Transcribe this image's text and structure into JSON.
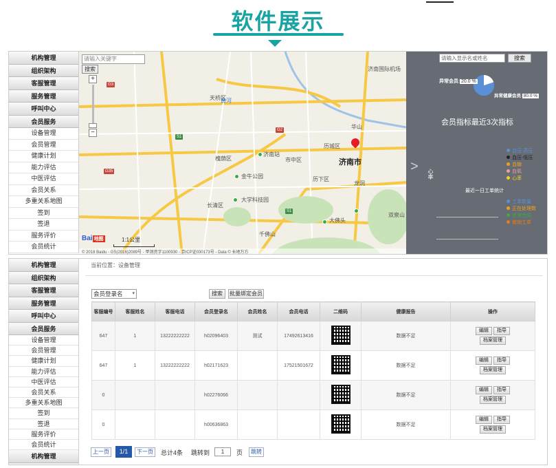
{
  "banner": {
    "title": "软件展示"
  },
  "sidebar_top": {
    "groups": [
      "机构管理",
      "组织架构",
      "客服管理",
      "服务管理",
      "呼叫中心",
      "会员服务"
    ],
    "items": [
      "设备管理",
      "会员管理",
      "健康计划",
      "能力评估",
      "中医评估",
      "会员关系",
      "多重关系地图",
      "签到",
      "签退",
      "服务评价",
      "会员统计"
    ]
  },
  "map": {
    "search_placeholder": "请输入关键字",
    "search_button": "搜索",
    "zoom_in": "+",
    "zoom_out": "−",
    "scale": "1:1公里",
    "logo": "Bai",
    "logo_box": "地图",
    "copyright": "© 2018 Baidu - GS(2016)2089号 - 甲测资字1100930 - 京ICP证030173号 - Data © 长地万方",
    "city": "济南市",
    "labels": [
      "天桥区",
      "历城区",
      "历下区",
      "市中区",
      "槐荫区",
      "长清区",
      "济南站",
      "龙洞",
      "华山",
      "金牛公园",
      "济南国际机场",
      "黄河",
      "大学科技园",
      "千佛山",
      "大佛头",
      "双泉山"
    ]
  },
  "dashboard": {
    "search_placeholder": "请输入显示名或姓名",
    "search_button": "搜索",
    "pct_a_label": "异常会员",
    "pct_a_value": "20.0 %",
    "pct_b_label": "异常健康会员",
    "pct_b_value": "80.0 %",
    "pie": {
      "slices": [
        {
          "value": 20.0,
          "color": "#ffffff"
        },
        {
          "value": 80.0,
          "color": "#5b8fd6"
        }
      ]
    },
    "heading": "会员指标最近3次指标",
    "arrow": ">",
    "vertical_label": "心率",
    "legend1": [
      {
        "label": "血压-高压",
        "color": "#5b8fd6"
      },
      {
        "label": "血压-低压",
        "color": "#222222"
      },
      {
        "label": "血糖",
        "color": "#f0a020"
      },
      {
        "label": "血氧",
        "color": "#e8a0a0"
      },
      {
        "label": "心率",
        "color": "#f0d020"
      }
    ],
    "sub_heading": "最近一日工单统计",
    "legend2": [
      {
        "label": "工单数量",
        "color": "#5b8fd6"
      },
      {
        "label": "正在处理数",
        "color": "#f0a020"
      },
      {
        "label": "处理完成",
        "color": "#3aaa4a"
      },
      {
        "label": "撤销工单",
        "color": "#e87a20"
      }
    ]
  },
  "sidebar_bottom": {
    "groups": [
      "机构管理",
      "组织架构",
      "客服管理",
      "服务管理",
      "呼叫中心",
      "会员服务"
    ],
    "items": [
      "设备管理",
      "会员管理",
      "健康计划",
      "能力评估",
      "中医评估",
      "会员关系",
      "多重关系地图",
      "签到",
      "签退",
      "服务评价",
      "会员统计"
    ],
    "tail": "机构管理"
  },
  "content": {
    "breadcrumb": "当前位置：设备管理",
    "filter_select": "会员登录名",
    "search_button": "搜索",
    "bind_button": "批量绑定会员",
    "columns": [
      "客服编号",
      "客服姓名",
      "客服电话",
      "会员登录名",
      "会员姓名",
      "会员电话",
      "二维码",
      "健康报告",
      "操作"
    ],
    "rows": [
      {
        "id": "647",
        "cs_name": "1",
        "cs_phone": "13222222222",
        "login": "h02096403",
        "name": "测试",
        "phone": "17492613416",
        "report": "数据不足"
      },
      {
        "id": "647",
        "cs_name": "1",
        "cs_phone": "13222222222",
        "login": "h02171623",
        "name": "",
        "phone": "17521501672",
        "report": "数据不足"
      },
      {
        "id": "0",
        "cs_name": "",
        "cs_phone": "",
        "login": "h02276066",
        "name": "",
        "phone": "",
        "report": "数据不足"
      },
      {
        "id": "0",
        "cs_name": "",
        "cs_phone": "",
        "login": "h00636863",
        "name": "",
        "phone": "",
        "report": "数据不足"
      }
    ],
    "op_edit": "编辑",
    "op_guide": "指导",
    "op_archive": "档案管理",
    "pager": {
      "prev": "上一页",
      "current": "1/1",
      "next": "下一页",
      "total": "总计4条",
      "jump_label": "跳转到",
      "page_value": "1",
      "page_unit": "页",
      "go": "跳转"
    }
  }
}
